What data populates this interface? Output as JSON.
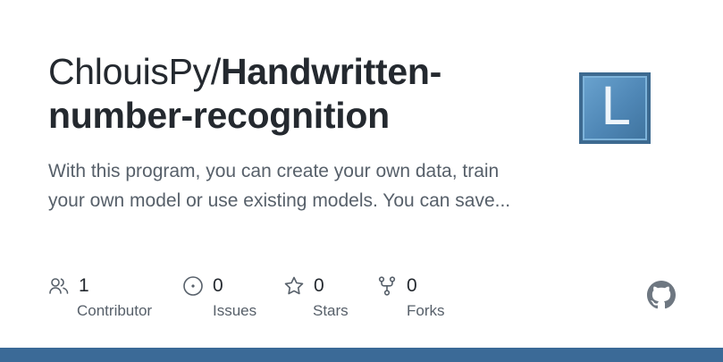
{
  "repo": {
    "owner": "ChlouisPy/",
    "name": "Handwritten-number-recognition",
    "description": "With this program, you can create your own data, train your own model or use existing models. You can save..."
  },
  "avatar": {
    "letter": "L",
    "color": "#4f87b6"
  },
  "stats": {
    "contributors": {
      "count": "1",
      "label": "Contributor",
      "icon": "people-icon"
    },
    "issues": {
      "count": "0",
      "label": "Issues",
      "icon": "issue-opened-icon"
    },
    "stars": {
      "count": "0",
      "label": "Stars",
      "icon": "star-icon"
    },
    "forks": {
      "count": "0",
      "label": "Forks",
      "icon": "repo-forked-icon"
    }
  },
  "brand": {
    "icon": "github-mark-icon",
    "bar_color": "#3b6a97"
  }
}
